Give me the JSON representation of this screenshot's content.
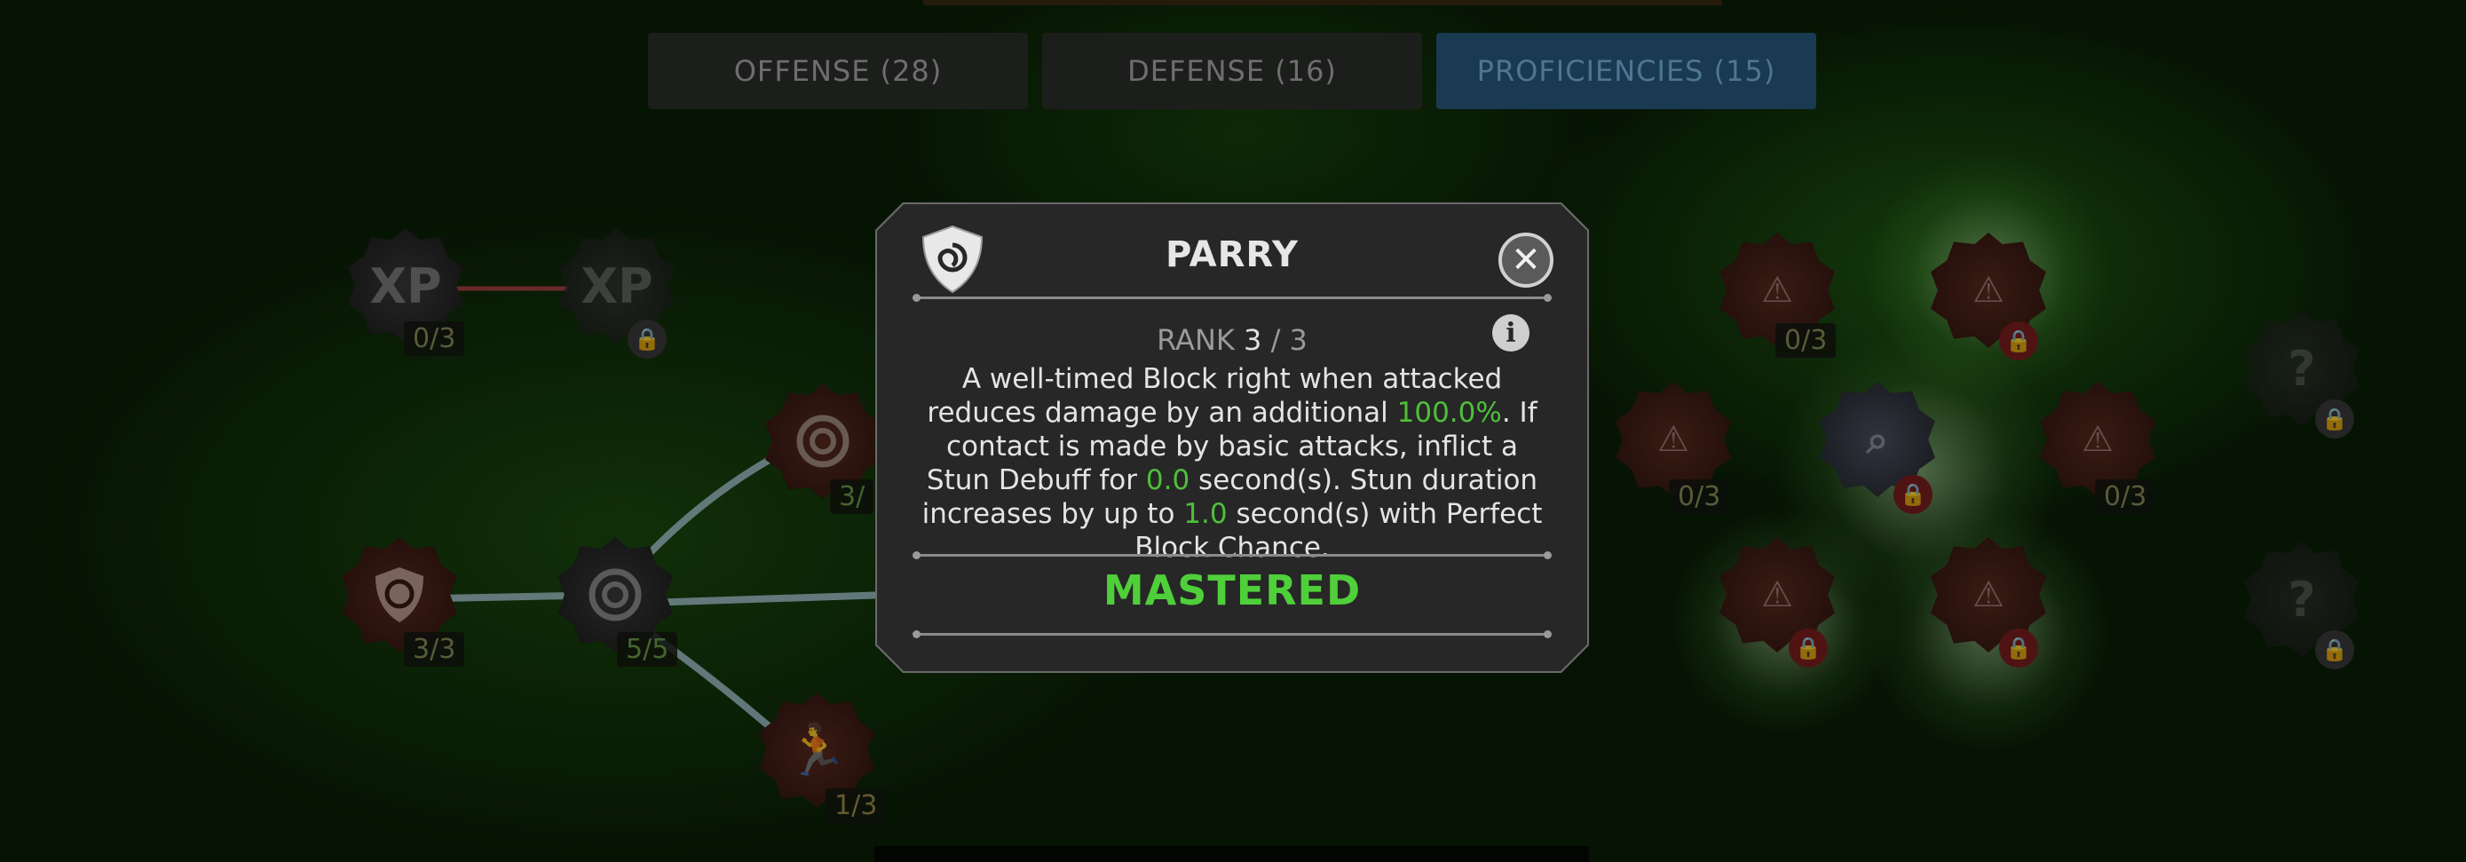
{
  "tabs": [
    {
      "label": "OFFENSE (28)",
      "active": false
    },
    {
      "label": "DEFENSE (16)",
      "active": false
    },
    {
      "label": "PROFICIENCIES (15)",
      "active": true
    }
  ],
  "tree": {
    "xp_node_1": {
      "label": "XP",
      "count": "0/3"
    },
    "xp_node_2": {
      "label": "XP"
    },
    "parry_node_count": "3/3",
    "block_node_count": "5/5",
    "swirl_node_count": "3/",
    "run_node_count": "1/3",
    "right_nodes": {
      "node_a_count": "0/3",
      "node_b_count": "0/3",
      "node_c_count": "0/3"
    },
    "unknown_label": "?"
  },
  "modal": {
    "title": "PARRY",
    "rank_label": "RANK",
    "rank_current": "3",
    "rank_sep": "/",
    "rank_max": "3",
    "desc_1": "A well-timed Block right when attacked reduces damage by an additional ",
    "value_1": "100.0%",
    "desc_2": ". If contact is made by basic attacks, inflict a Stun Debuff for ",
    "value_2": "0.0",
    "desc_3": " second(s). Stun duration increases by up to ",
    "value_3": "1.0",
    "desc_4": " second(s) with Perfect Block Chance.",
    "status": "MASTERED",
    "close_glyph": "✕",
    "info_glyph": "i"
  },
  "colors": {
    "highlight": "#4fbf3a",
    "active_tab": "#1a3a52"
  }
}
